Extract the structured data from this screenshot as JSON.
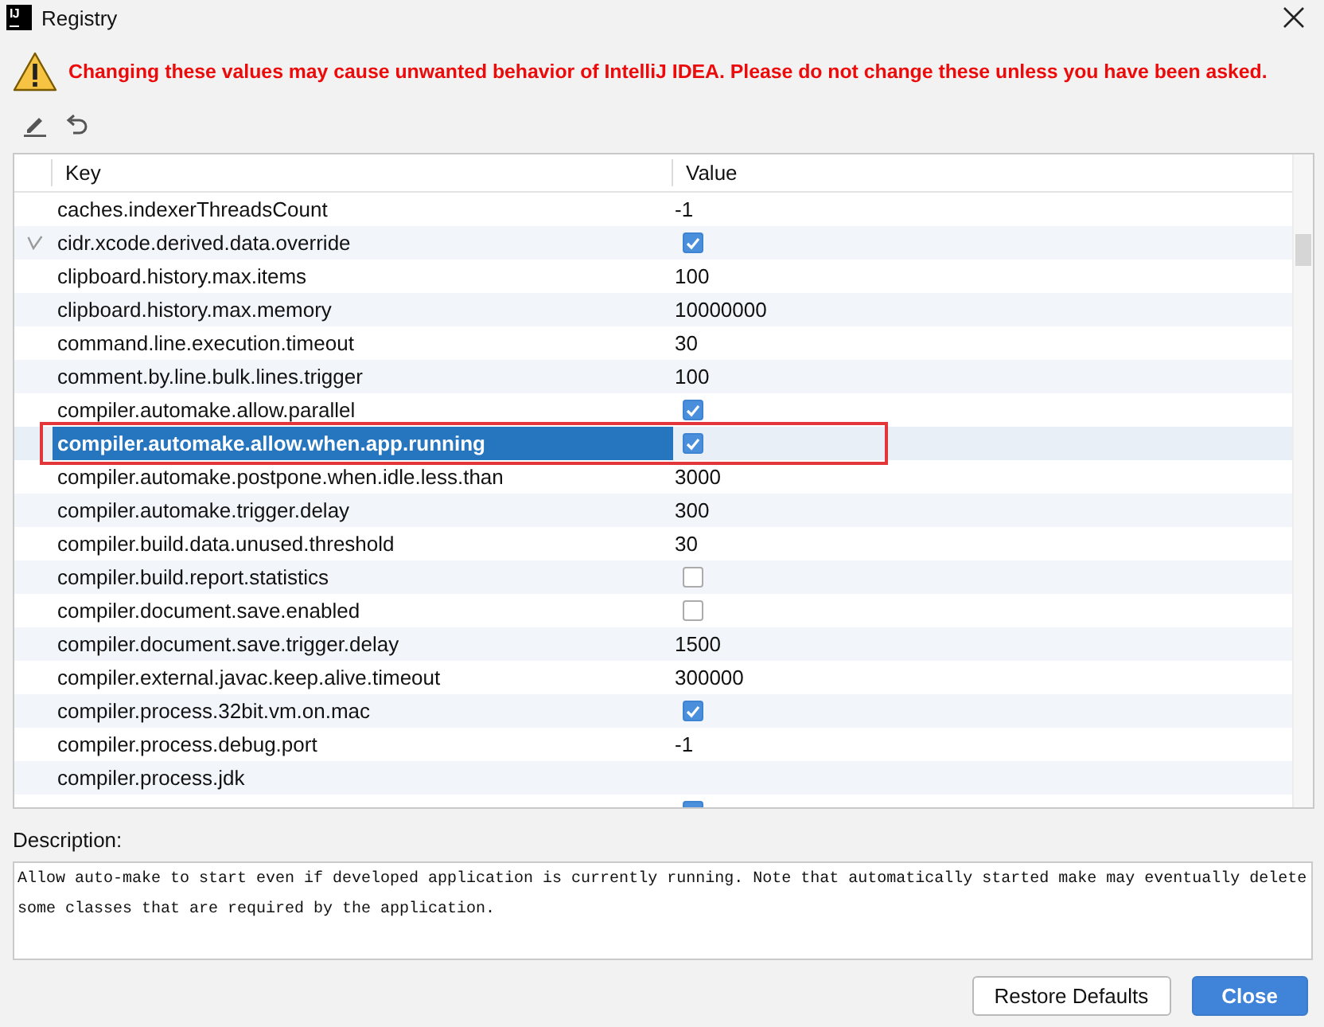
{
  "window": {
    "title": "Registry",
    "icon_label": "IJ"
  },
  "warning": {
    "text": "Changing these values may cause unwanted behavior of IntelliJ IDEA. Please do not change these unless you have been asked."
  },
  "table": {
    "columns": [
      "Key",
      "Value"
    ],
    "rows": [
      {
        "key": "caches.indexerThreadsCount",
        "kind": "text",
        "value": "-1",
        "selected": false,
        "modified": false,
        "outlined": false
      },
      {
        "key": "cidr.xcode.derived.data.override",
        "kind": "checkbox",
        "checked": true,
        "selected": false,
        "modified": true,
        "outlined": false
      },
      {
        "key": "clipboard.history.max.items",
        "kind": "text",
        "value": "100",
        "selected": false,
        "modified": false,
        "outlined": false
      },
      {
        "key": "clipboard.history.max.memory",
        "kind": "text",
        "value": "10000000",
        "selected": false,
        "modified": false,
        "outlined": false
      },
      {
        "key": "command.line.execution.timeout",
        "kind": "text",
        "value": "30",
        "selected": false,
        "modified": false,
        "outlined": false
      },
      {
        "key": "comment.by.line.bulk.lines.trigger",
        "kind": "text",
        "value": "100",
        "selected": false,
        "modified": false,
        "outlined": false
      },
      {
        "key": "compiler.automake.allow.parallel",
        "kind": "checkbox",
        "checked": true,
        "selected": false,
        "modified": false,
        "outlined": false
      },
      {
        "key": "compiler.automake.allow.when.app.running",
        "kind": "checkbox",
        "checked": true,
        "selected": true,
        "modified": false,
        "outlined": true
      },
      {
        "key": "compiler.automake.postpone.when.idle.less.than",
        "kind": "text",
        "value": "3000",
        "selected": false,
        "modified": false,
        "outlined": false
      },
      {
        "key": "compiler.automake.trigger.delay",
        "kind": "text",
        "value": "300",
        "selected": false,
        "modified": false,
        "outlined": false
      },
      {
        "key": "compiler.build.data.unused.threshold",
        "kind": "text",
        "value": "30",
        "selected": false,
        "modified": false,
        "outlined": false
      },
      {
        "key": "compiler.build.report.statistics",
        "kind": "checkbox",
        "checked": false,
        "selected": false,
        "modified": false,
        "outlined": false
      },
      {
        "key": "compiler.document.save.enabled",
        "kind": "checkbox",
        "checked": false,
        "selected": false,
        "modified": false,
        "outlined": false
      },
      {
        "key": "compiler.document.save.trigger.delay",
        "kind": "text",
        "value": "1500",
        "selected": false,
        "modified": false,
        "outlined": false
      },
      {
        "key": "compiler.external.javac.keep.alive.timeout",
        "kind": "text",
        "value": "300000",
        "selected": false,
        "modified": false,
        "outlined": false
      },
      {
        "key": "compiler.process.32bit.vm.on.mac",
        "kind": "checkbox",
        "checked": true,
        "selected": false,
        "modified": false,
        "outlined": false
      },
      {
        "key": "compiler.process.debug.port",
        "kind": "text",
        "value": "-1",
        "selected": false,
        "modified": false,
        "outlined": false
      },
      {
        "key": "compiler.process.jdk",
        "kind": "text",
        "selected": false,
        "modified": false,
        "outlined": false
      },
      {
        "kind": "checkbox",
        "checked": true,
        "selected": false,
        "modified": false,
        "outlined": false
      }
    ]
  },
  "description": {
    "label": "Description:",
    "text": "Allow auto-make to start even if developed application is currently running. Note that automatically started make may eventually delete some classes that are required by the application."
  },
  "buttons": [
    {
      "label": "Restore Defaults",
      "primary": false
    },
    {
      "label": "Close",
      "primary": true
    }
  ]
}
